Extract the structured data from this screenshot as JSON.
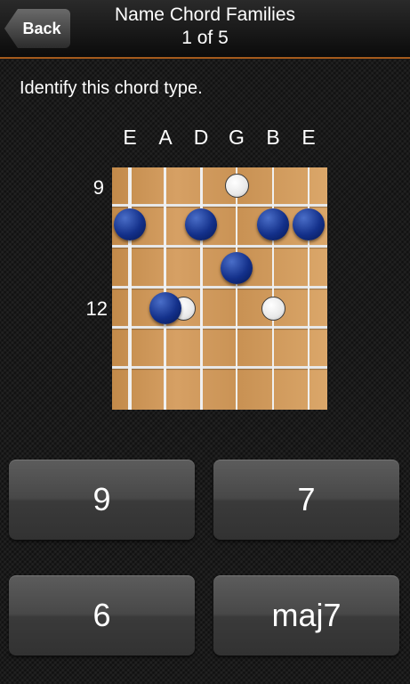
{
  "header": {
    "back_label": "Back",
    "title": "Name Chord Families",
    "progress": "1 of 5"
  },
  "prompt": "Identify this chord type.",
  "diagram": {
    "strings": [
      "E",
      "A",
      "D",
      "G",
      "B",
      "E"
    ],
    "fret_labels": [
      {
        "text": "9",
        "row": 0
      },
      {
        "text": "12",
        "row": 3
      }
    ],
    "notes": [
      {
        "string": 3,
        "row": 0,
        "style": "open-circle"
      },
      {
        "string": 0,
        "row": 1,
        "style": "filled"
      },
      {
        "string": 2,
        "row": 1,
        "style": "filled"
      },
      {
        "string": 4,
        "row": 1,
        "style": "filled"
      },
      {
        "string": 5,
        "row": 1,
        "style": "filled"
      },
      {
        "string": 3,
        "row": 2,
        "style": "filled"
      },
      {
        "string": 1.5,
        "row": 3,
        "style": "open-circle"
      },
      {
        "string": 4,
        "row": 3,
        "style": "open-circle"
      },
      {
        "string": 1,
        "row": 3,
        "style": "filled"
      }
    ]
  },
  "answers": [
    "9",
    "7",
    "6",
    "maj7"
  ]
}
